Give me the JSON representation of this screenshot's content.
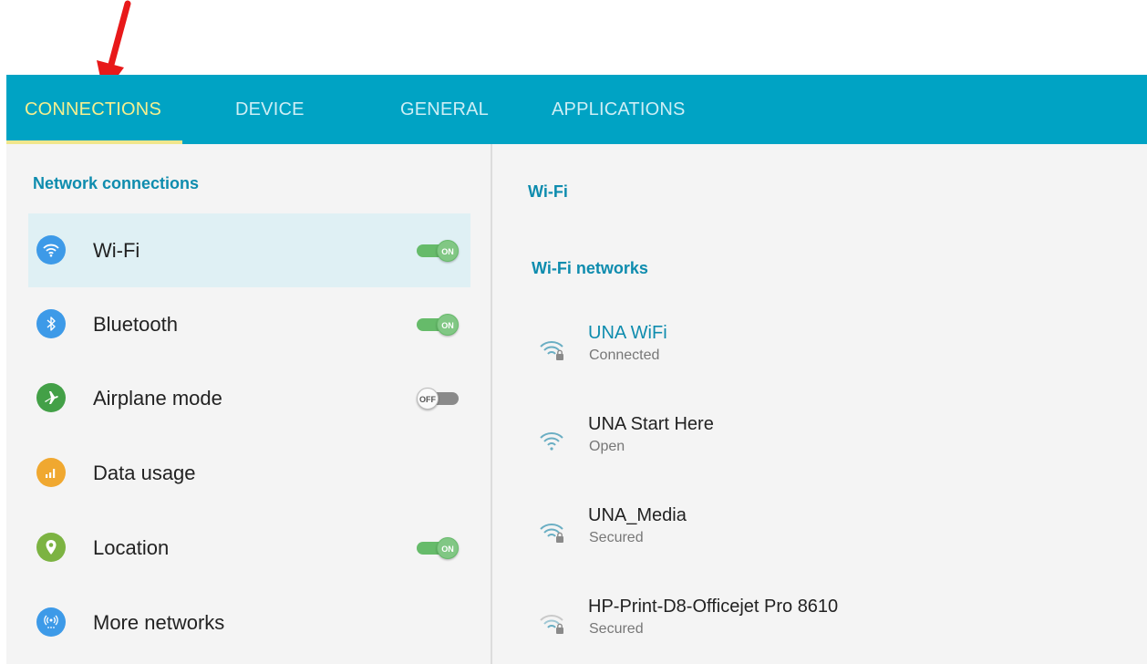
{
  "tabs": [
    {
      "label": "CONNECTIONS",
      "active": true
    },
    {
      "label": "DEVICE",
      "active": false
    },
    {
      "label": "GENERAL",
      "active": false
    },
    {
      "label": "APPLICATIONS",
      "active": false
    }
  ],
  "left_panel": {
    "section_title": "Network connections",
    "items": [
      {
        "label": "Wi-Fi",
        "icon": "wifi-icon",
        "icon_color": "#3d9ae8",
        "toggle": "ON",
        "selected": true
      },
      {
        "label": "Bluetooth",
        "icon": "bluetooth-icon",
        "icon_color": "#3d9ae8",
        "toggle": "ON",
        "selected": false
      },
      {
        "label": "Airplane mode",
        "icon": "airplane-icon",
        "icon_color": "#43a047",
        "toggle": "OFF",
        "selected": false
      },
      {
        "label": "Data usage",
        "icon": "data-usage-icon",
        "icon_color": "#f0a830",
        "toggle": null,
        "selected": false
      },
      {
        "label": "Location",
        "icon": "location-icon",
        "icon_color": "#7cb342",
        "toggle": "ON",
        "selected": false
      },
      {
        "label": "More networks",
        "icon": "more-networks-icon",
        "icon_color": "#3d9ae8",
        "toggle": null,
        "selected": false
      }
    ]
  },
  "right_panel": {
    "title": "Wi-Fi",
    "subtitle": "Wi-Fi networks",
    "networks": [
      {
        "name": "UNA WiFi",
        "status": "Connected",
        "secured": true,
        "connected": true
      },
      {
        "name": "UNA Start Here",
        "status": "Open",
        "secured": false,
        "connected": false
      },
      {
        "name": "UNA_Media",
        "status": "Secured",
        "secured": true,
        "connected": false
      },
      {
        "name": "HP-Print-D8-Officejet Pro 8610",
        "status": "Secured",
        "secured": true,
        "connected": false
      }
    ]
  },
  "colors": {
    "tabbar": "#00a3c4",
    "accent_text": "#0e8cae",
    "active_tab": "#f5ef8f",
    "annotation_arrow": "#e8191a"
  }
}
